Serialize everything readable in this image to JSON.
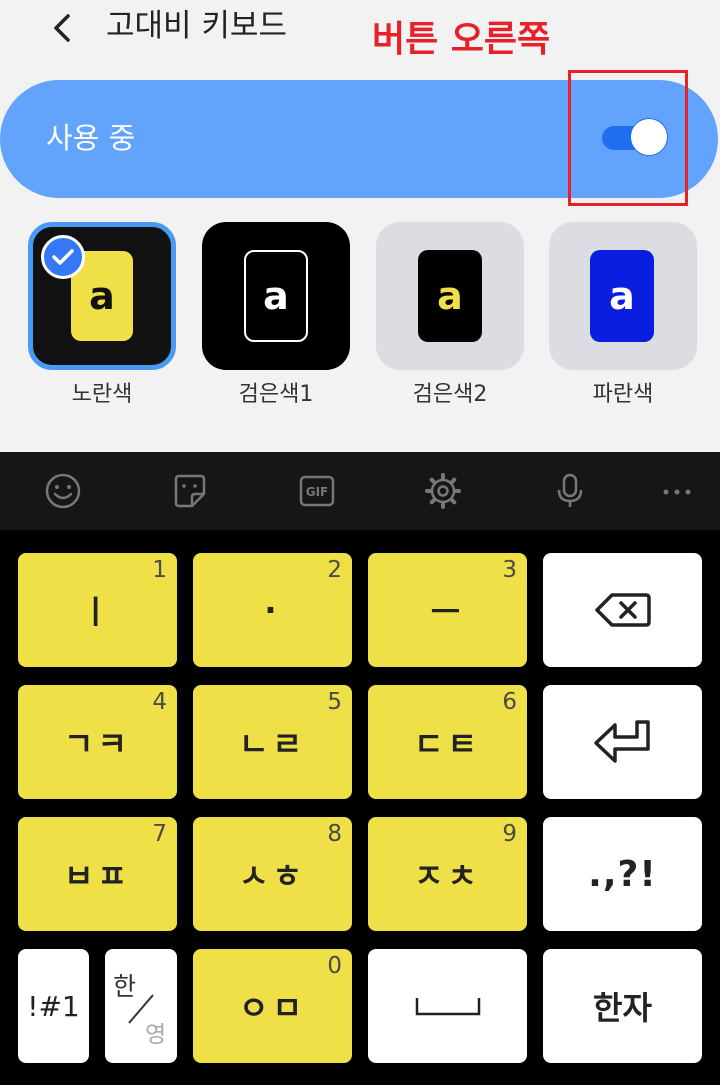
{
  "header": {
    "title": "고대비 키보드",
    "back_icon": "chevron-left-icon"
  },
  "annotation": {
    "text": "버튼 오른쪽",
    "color": "#e8202a"
  },
  "toggle": {
    "label": "사용 중",
    "state": "on",
    "color": "#62a3fb"
  },
  "themes": [
    {
      "label": "노란색",
      "selected": true,
      "letter": "a"
    },
    {
      "label": "검은색1",
      "selected": false,
      "letter": "a"
    },
    {
      "label": "검은색2",
      "selected": false,
      "letter": "a"
    },
    {
      "label": "파란색",
      "selected": false,
      "letter": "a"
    }
  ],
  "toolbar": {
    "icons": [
      "emoji-icon",
      "sticker-icon",
      "gif-icon",
      "settings-icon",
      "microphone-icon",
      "more-icon"
    ],
    "gif_text": "GIF"
  },
  "keyboard": {
    "keys": [
      {
        "label": "ㅣ",
        "num": "1"
      },
      {
        "label": "·",
        "num": "2"
      },
      {
        "label": "ㅡ",
        "num": "3"
      },
      {
        "label": "ㄱㅋ",
        "num": "4"
      },
      {
        "label": "ㄴㄹ",
        "num": "5"
      },
      {
        "label": "ㄷㅌ",
        "num": "6"
      },
      {
        "label": "ㅂㅍ",
        "num": "7"
      },
      {
        "label": "ㅅㅎ",
        "num": "8"
      },
      {
        "label": "ㅈㅊ",
        "num": "9"
      },
      {
        "label": "ㅇㅁ",
        "num": "0"
      }
    ],
    "punct": ".,?!",
    "symbols": "!#1",
    "lang_top": "한",
    "lang_bottom": "영",
    "hanja": "한자",
    "backspace_icon": "backspace-icon",
    "enter_icon": "enter-icon",
    "space_icon": "space-icon",
    "key_color": "#f0e047"
  }
}
